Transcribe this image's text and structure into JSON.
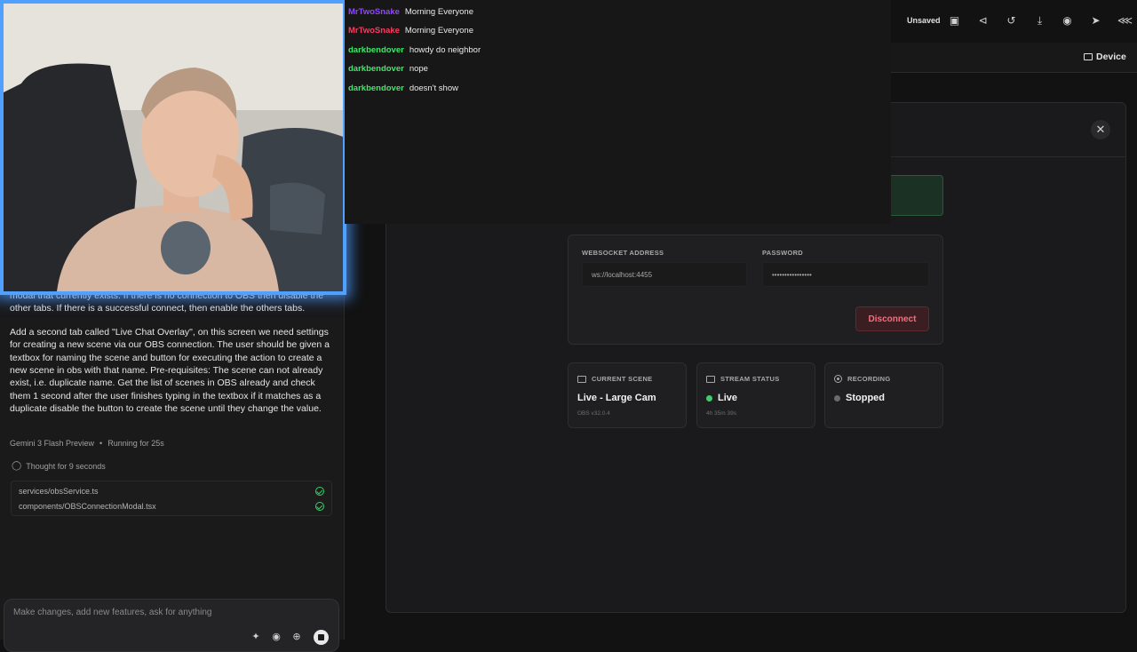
{
  "chat": {
    "prompt_partial": "modal that currently exists. If there is no connection to OBS then disable the other tabs. If there is a successful connect, then enable the others tabs.",
    "prompt_main": "Add a second tab called \"Live Chat Overlay\", on this screen we need settings for creating a new scene via our OBS connection. The user should be given a textbox for naming the scene and button for executing the action to create a new scene in obs with that name. Pre-requisites: The scene can not already exist, i.e. duplicate name. Get the list of scenes in OBS already and check them 1 second after the user finishes typing in the textbox if it matches as a duplicate disable the button to create the scene until they change the value.",
    "model": "Gemini 3 Flash Preview",
    "separator": "•",
    "running": "Running for 25s",
    "thought": "Thought for 9 seconds",
    "files": [
      "services/obsService.ts",
      "components/OBSConnectionModal.tsx"
    ],
    "composer_placeholder": "Make changes, add new features, ask for anything"
  },
  "stream_chat": [
    {
      "user": "MrTwoSnake",
      "text": "Morning Everyone",
      "color": "#9147ff"
    },
    {
      "user": "MrTwoSnake",
      "text": "Morning Everyone",
      "color": "#ff3b5c"
    },
    {
      "user": "darkbendover",
      "text": "howdy do neighbor",
      "color": "#3ee86a"
    },
    {
      "user": "darkbendover",
      "text": "nope",
      "color": "#3ee86a"
    },
    {
      "user": "darkbendover",
      "text": "doesn't show",
      "color": "#3ee86a"
    }
  ],
  "toolbar": {
    "unsaved": "Unsaved",
    "device": "Device",
    "icons": [
      "save-icon",
      "share-nodes-icon",
      "history-icon",
      "download-icon",
      "github-icon",
      "rocket-icon",
      "share-icon"
    ]
  },
  "modal": {
    "close": "✕",
    "ws_label": "WEBSOCKET ADDRESS",
    "ws_value": "ws://localhost:4455",
    "pw_label": "PASSWORD",
    "pw_value": "••••••••••••••••",
    "disconnect": "Disconnect",
    "cards": {
      "scene": {
        "title": "CURRENT SCENE",
        "value": "Live - Large Cam",
        "sub": "OBS v32.0.4"
      },
      "stream": {
        "title": "STREAM STATUS",
        "value": "Live",
        "sub": "4h 35m 39s",
        "dot": "#3ecf6a"
      },
      "recording": {
        "title": "RECORDING",
        "value": "Stopped",
        "dot": "#6b6b6b"
      }
    }
  },
  "colors": {
    "accent_danger": "#ff6b78",
    "live_green": "#3ecf6a",
    "cam_border": "#4fa0ff"
  }
}
